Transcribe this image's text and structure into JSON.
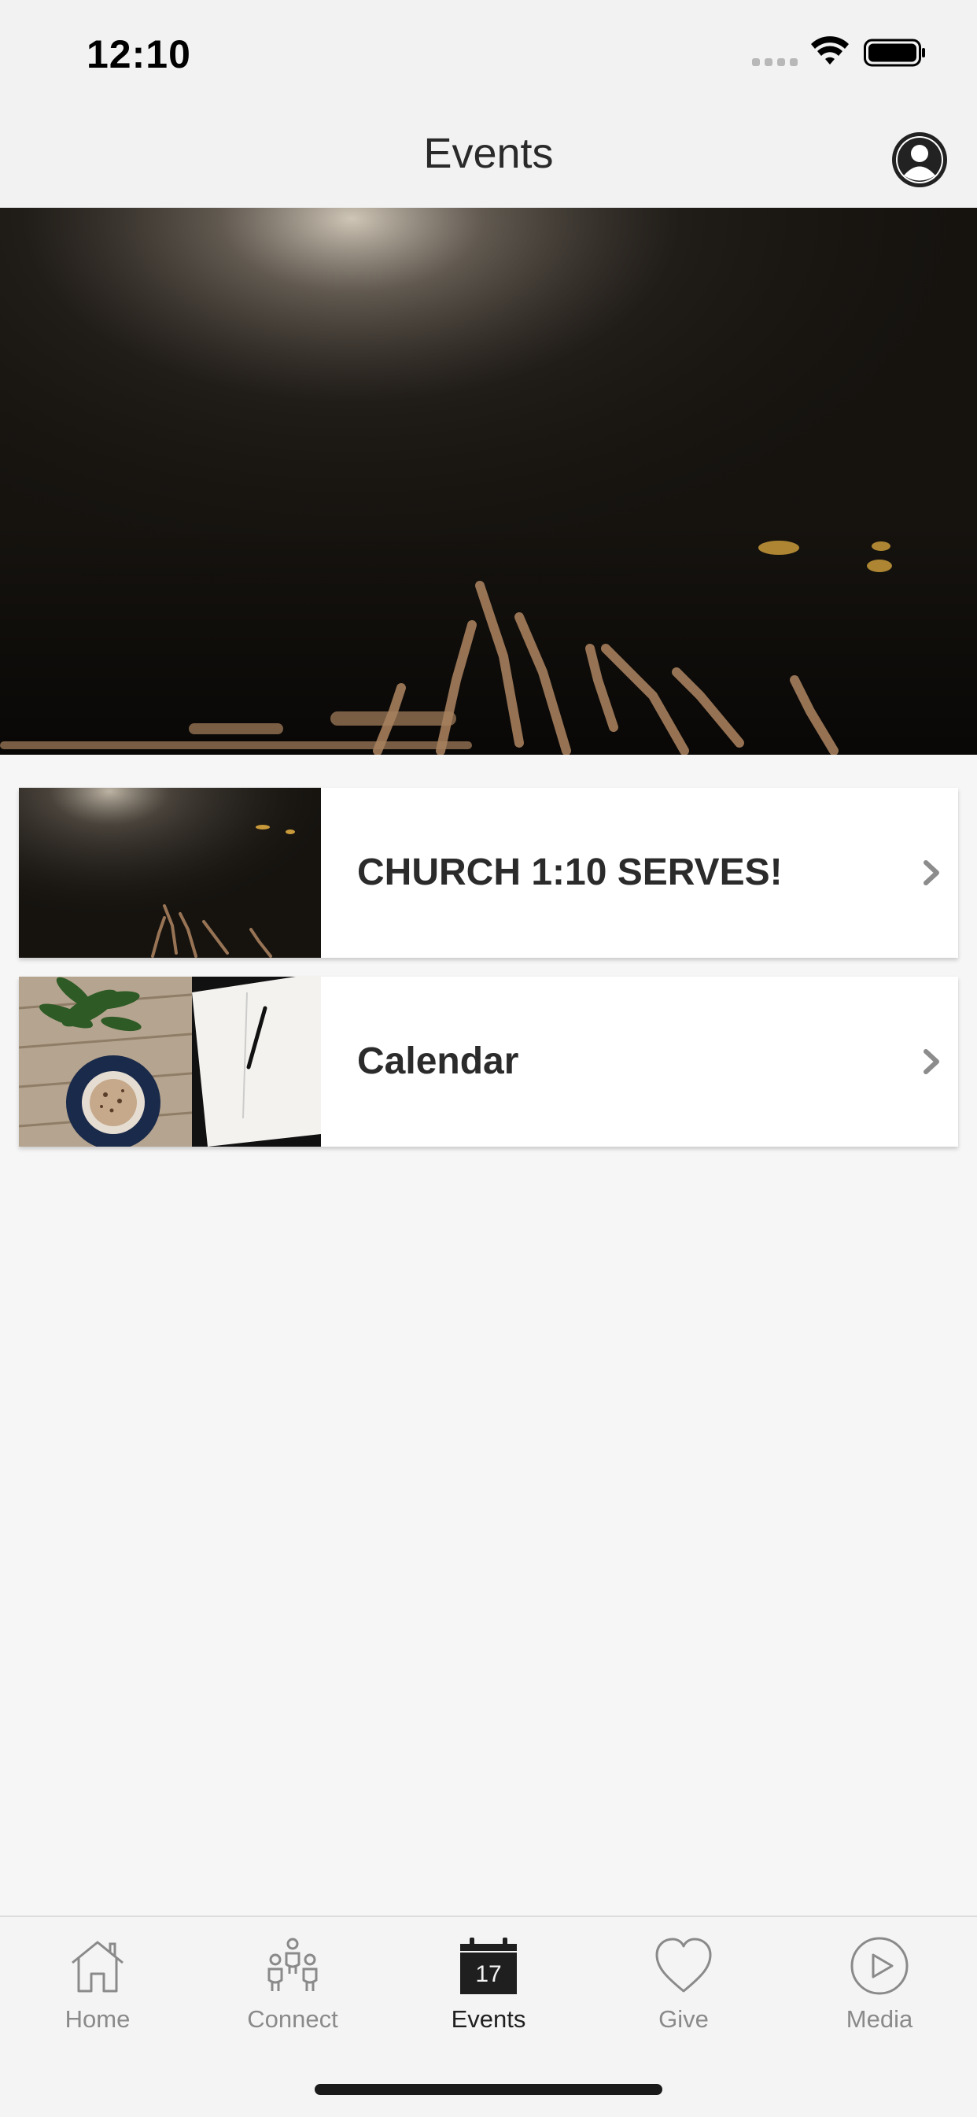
{
  "status_bar": {
    "time": "12:10"
  },
  "header": {
    "title": "Events",
    "profile_icon": "person-circle-icon"
  },
  "hero": {
    "image": "worship-hands-raised-photo"
  },
  "events_list": [
    {
      "title": "CHURCH 1:10 SERVES!",
      "thumbnail": "worship-hands-raised-photo",
      "chevron": "chevron-right-icon"
    },
    {
      "title": "Calendar",
      "thumbnail": "coffee-notebook-desk-photo",
      "chevron": "chevron-right-icon"
    }
  ],
  "tab_bar": {
    "active": "Events",
    "tabs": [
      {
        "label": "Home",
        "icon": "home-icon"
      },
      {
        "label": "Connect",
        "icon": "people-group-icon"
      },
      {
        "label": "Events",
        "icon": "calendar-icon",
        "icon_text": "17"
      },
      {
        "label": "Give",
        "icon": "heart-icon"
      },
      {
        "label": "Media",
        "icon": "play-circle-icon"
      }
    ]
  },
  "colors": {
    "background": "#f6f6f6",
    "bar": "#f2f2f2",
    "active_tab": "#1f1f1f",
    "inactive_tab": "#8a8a8a"
  }
}
